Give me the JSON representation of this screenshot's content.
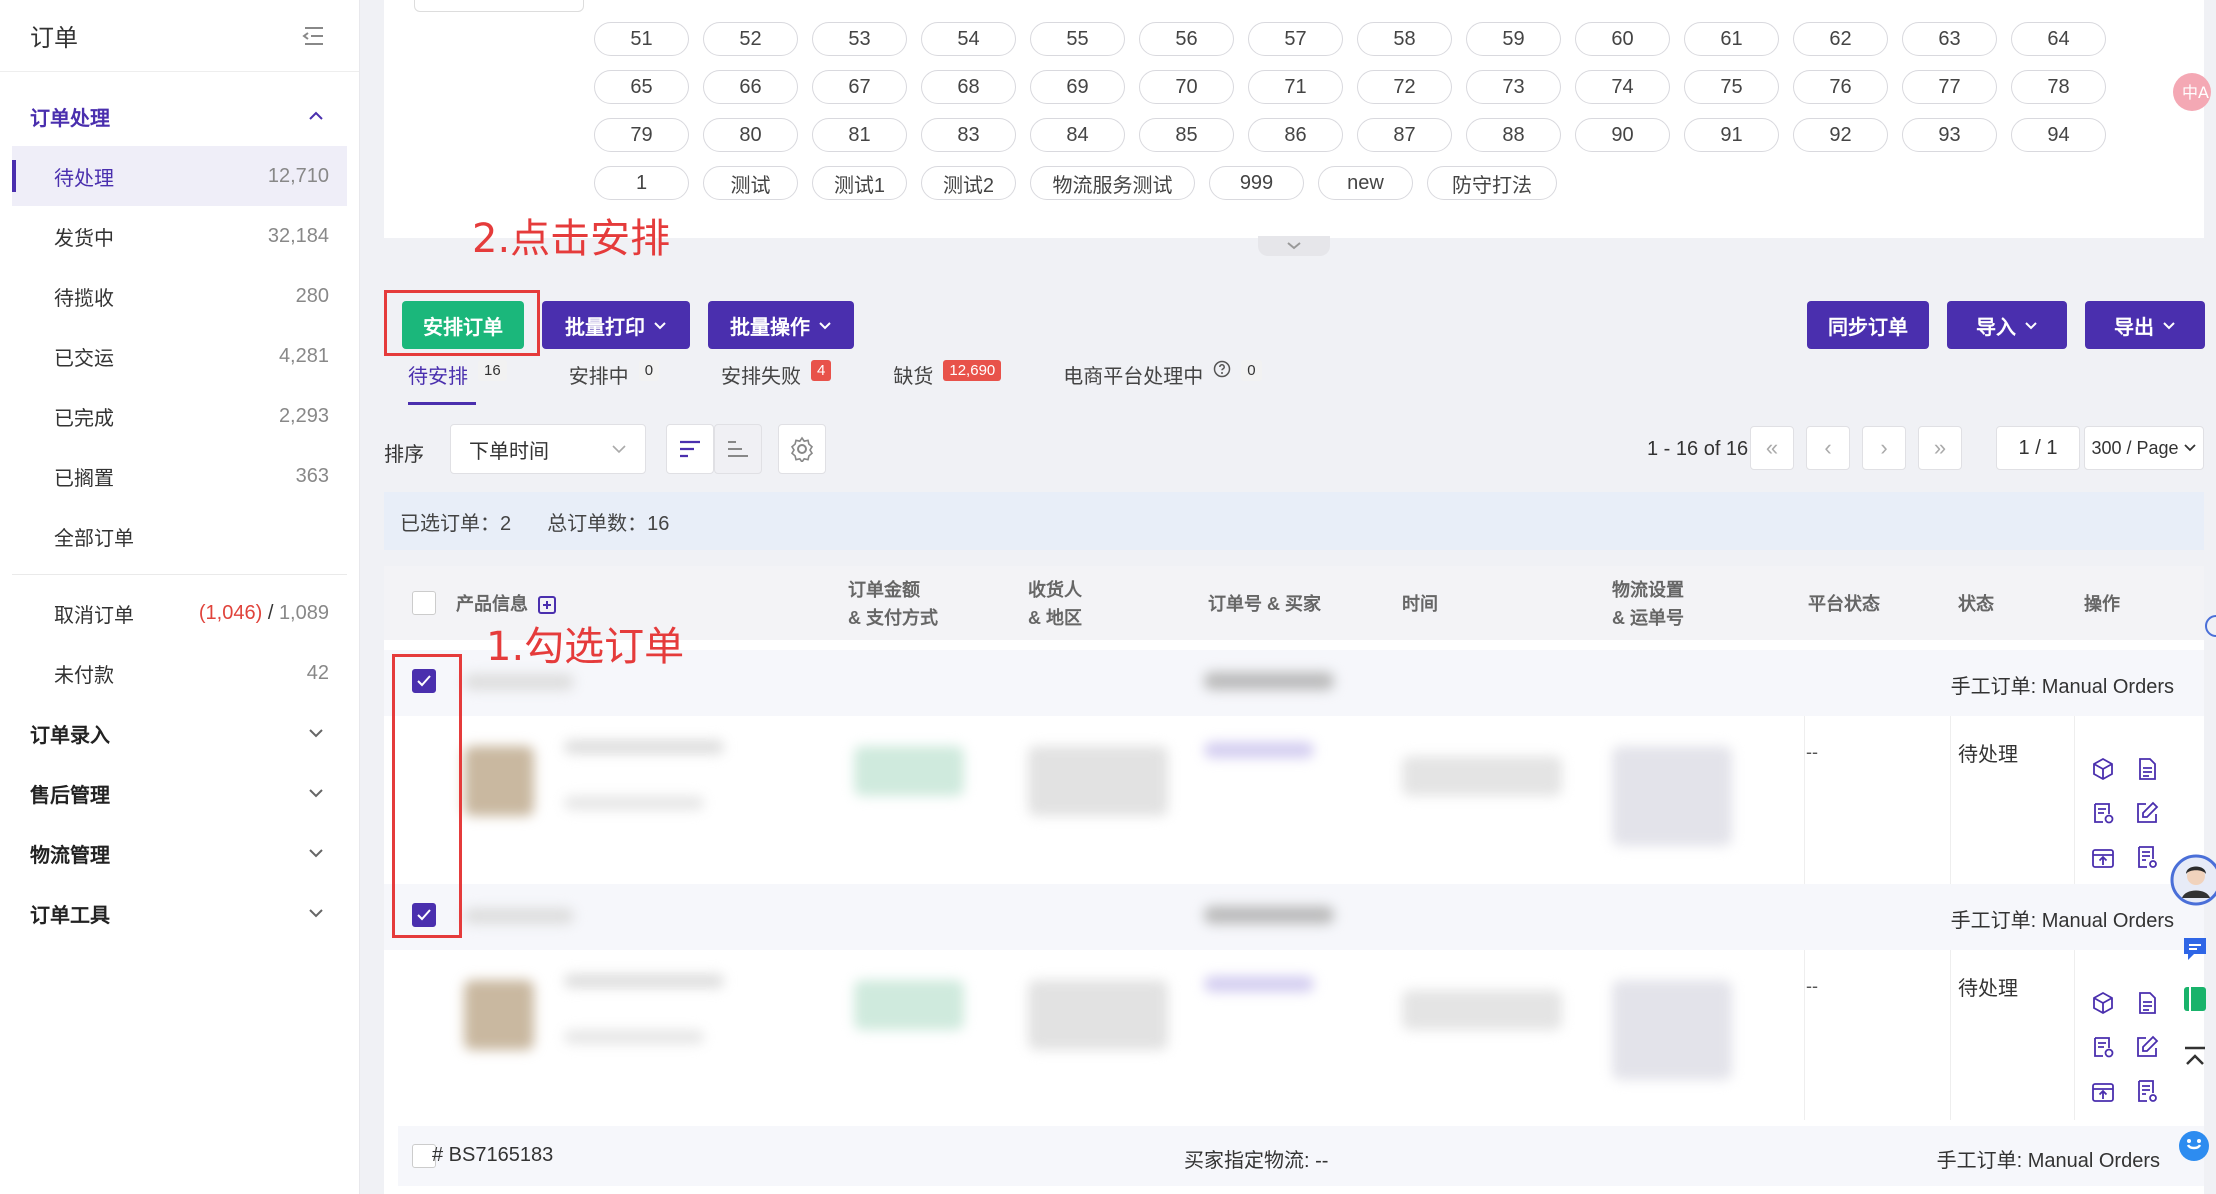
{
  "sidebar": {
    "title": "订单",
    "groups": [
      {
        "label": "订单处理"
      },
      {
        "label": "订单录入"
      },
      {
        "label": "售后管理"
      },
      {
        "label": "物流管理"
      },
      {
        "label": "订单工具"
      }
    ],
    "items": [
      {
        "label": "待处理",
        "count": "12,710"
      },
      {
        "label": "发货中",
        "count": "32,184"
      },
      {
        "label": "待揽收",
        "count": "280"
      },
      {
        "label": "已交运",
        "count": "4,281"
      },
      {
        "label": "已完成",
        "count": "2,293"
      },
      {
        "label": "已搁置",
        "count": "363"
      },
      {
        "label": "全部订单",
        "count": ""
      }
    ],
    "cancel": {
      "label": "取消订单",
      "red": "(1,046)",
      "sep": " / ",
      "total": "1,089"
    },
    "unpaid": {
      "label": "未付款",
      "count": "42"
    }
  },
  "chips": {
    "row1": [
      "51",
      "52",
      "53",
      "54",
      "55",
      "56",
      "57",
      "58",
      "59",
      "60",
      "61",
      "62",
      "63",
      "64"
    ],
    "row2": [
      "65",
      "66",
      "67",
      "68",
      "69",
      "70",
      "71",
      "72",
      "73",
      "74",
      "75",
      "76",
      "77",
      "78"
    ],
    "row3": [
      "79",
      "80",
      "81",
      "83",
      "84",
      "85",
      "86",
      "87",
      "88",
      "90",
      "91",
      "92",
      "93",
      "94"
    ],
    "row4": [
      "1",
      "测试",
      "测试1",
      "测试2",
      "物流服务测试",
      "999",
      "new",
      "防守打法"
    ]
  },
  "annotations": {
    "step1": "1.勾选订单",
    "step2": "2.点击安排"
  },
  "toolbar": {
    "arrange": "安排订单",
    "batch_print": "批量打印",
    "batch_ops": "批量操作",
    "sync": "同步订单",
    "import": "导入",
    "export": "导出"
  },
  "tabs": [
    {
      "label": "待安排",
      "badge": "16"
    },
    {
      "label": "安排中",
      "badge": "0"
    },
    {
      "label": "安排失败",
      "badge": "4"
    },
    {
      "label": "缺货",
      "badge": "12,690"
    },
    {
      "label": "电商平台处理中",
      "badge": "0"
    }
  ],
  "sort": {
    "label": "排序",
    "value": "下单时间"
  },
  "pager": {
    "range": "1 - 16 of 16",
    "page": "1 / 1",
    "size": "300 / Page"
  },
  "summary": {
    "selected": "已选订单：2",
    "total": "总订单数：16"
  },
  "table": {
    "headers": {
      "product": "产品信息",
      "amount1": "订单金额",
      "amount2": "& 支付方式",
      "recv1": "收货人",
      "recv2": "& 地区",
      "order_no": "订单号 & 买家",
      "time": "时间",
      "logi1": "物流设置",
      "logi2": "& 运单号",
      "platform": "平台状态",
      "state": "状态",
      "ops": "操作"
    },
    "orders": [
      {
        "source": "手工订单: Manual Orders",
        "platform": "--",
        "state": "待处理"
      },
      {
        "source": "手工订单: Manual Orders",
        "platform": "--",
        "state": "待处理"
      },
      {
        "number": "# BS7165183",
        "buyer_logistics": "买家指定物流: --",
        "source": "手工订单: Manual Orders"
      }
    ]
  },
  "colors": {
    "brand": "#4a2fae",
    "green": "#1bb77b",
    "annotation": "#e53b3b"
  }
}
